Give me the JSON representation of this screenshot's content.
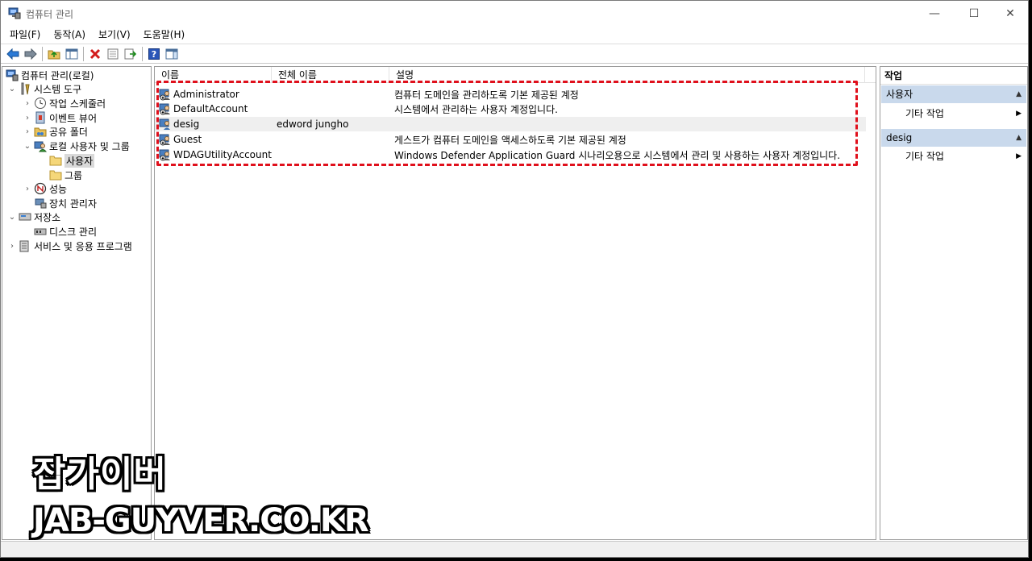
{
  "window": {
    "title": "컴퓨터 관리",
    "controls": {
      "minimize": "—",
      "maximize": "☐",
      "close": "✕"
    }
  },
  "menu": [
    "파일(F)",
    "동작(A)",
    "보기(V)",
    "도움말(H)"
  ],
  "toolbar": {
    "icons": [
      "back-arrow-icon",
      "forward-arrow-icon",
      "up-folder-icon",
      "show-hide-tree-icon",
      "delete-icon",
      "properties-icon",
      "export-list-icon",
      "help-icon",
      "show-action-pane-icon"
    ]
  },
  "tree": {
    "items": [
      {
        "label": "컴퓨터 관리(로컬)",
        "icon": "computer-management-icon",
        "expander": "",
        "level": 0
      },
      {
        "label": "시스템 도구",
        "icon": "system-tools-icon",
        "expander": "⌄",
        "level": 1
      },
      {
        "label": "작업 스케줄러",
        "icon": "clock-icon",
        "expander": "›",
        "level": 2
      },
      {
        "label": "이벤트 뷰어",
        "icon": "event-viewer-icon",
        "expander": "›",
        "level": 2
      },
      {
        "label": "공유 폴더",
        "icon": "shared-folder-icon",
        "expander": "›",
        "level": 2
      },
      {
        "label": "로컬 사용자 및 그룹",
        "icon": "users-groups-icon",
        "expander": "⌄",
        "level": 2
      },
      {
        "label": "사용자",
        "icon": "folder-icon",
        "expander": "",
        "level": 3,
        "selected": true
      },
      {
        "label": "그룹",
        "icon": "folder-icon",
        "expander": "",
        "level": 3
      },
      {
        "label": "성능",
        "icon": "performance-icon",
        "expander": "›",
        "level": 2
      },
      {
        "label": "장치 관리자",
        "icon": "device-manager-icon",
        "expander": "",
        "level": 2
      },
      {
        "label": "저장소",
        "icon": "storage-icon",
        "expander": "⌄",
        "level": 1
      },
      {
        "label": "디스크 관리",
        "icon": "disk-management-icon",
        "expander": "",
        "level": 2
      },
      {
        "label": "서비스 및 응용 프로그램",
        "icon": "services-icon",
        "expander": "›",
        "level": 1
      }
    ]
  },
  "list": {
    "columns": [
      "이름",
      "전체 이름",
      "설명"
    ],
    "rows": [
      {
        "name": "Administrator",
        "full_name": "",
        "description": "컴퓨터 도메인을 관리하도록 기본 제공된 계정"
      },
      {
        "name": "DefaultAccount",
        "full_name": "",
        "description": "시스템에서 관리하는 사용자 계정입니다."
      },
      {
        "name": "desig",
        "full_name": "edword jungho",
        "description": ""
      },
      {
        "name": "Guest",
        "full_name": "",
        "description": "게스트가 컴퓨터 도메인을 액세스하도록 기본 제공된 계정"
      },
      {
        "name": "WDAGUtilityAccount",
        "full_name": "",
        "description": "Windows Defender Application Guard 시나리오용으로 시스템에서 관리 및 사용하는 사용자 계정입니다."
      }
    ],
    "highlight_color": "#e0101c"
  },
  "actions": {
    "header": "작업",
    "sections": [
      {
        "title": "사용자",
        "items": [
          "기타 작업"
        ]
      },
      {
        "title": "desig",
        "items": [
          "기타 작업"
        ]
      }
    ],
    "section_color": "#c9d9ec"
  },
  "watermark": {
    "korean": "잡가이버",
    "english": "JAB-GUYVER.CO.KR"
  }
}
